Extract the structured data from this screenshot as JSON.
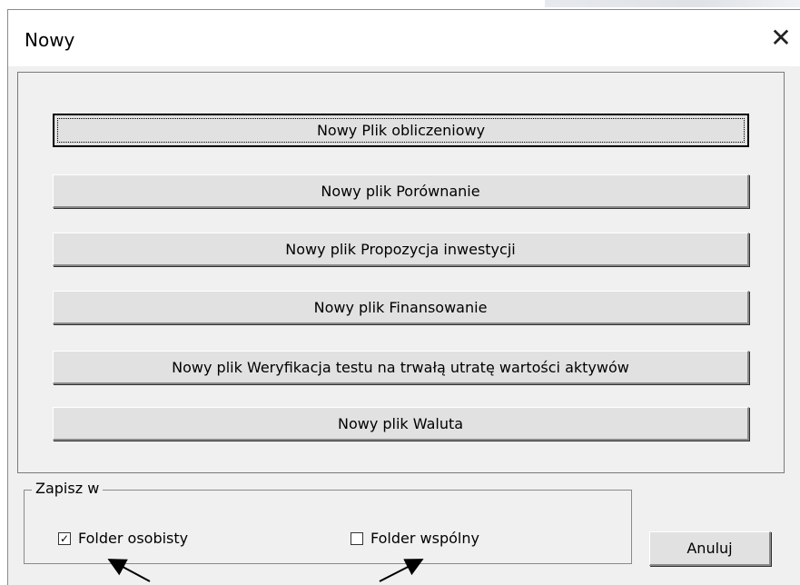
{
  "dialog": {
    "title": "Nowy",
    "close_icon": "close-icon"
  },
  "buttons": [
    {
      "label": "Nowy Plik obliczeniowy",
      "default": true
    },
    {
      "label": "Nowy plik Porównanie"
    },
    {
      "label": "Nowy plik Propozycja inwestycji"
    },
    {
      "label": "Nowy plik Finansowanie"
    },
    {
      "label": "Nowy plik Weryfikacja testu na trwałą utratę wartości aktywów"
    },
    {
      "label": "Nowy plik Waluta"
    }
  ],
  "save_in": {
    "legend": "Zapisz w",
    "options": [
      {
        "label": "Folder osobisty",
        "checked": true
      },
      {
        "label": "Folder wspólny",
        "checked": false
      }
    ]
  },
  "cancel_label": "Anuluj",
  "colors": {
    "dialog_bg": "#f0f0f0",
    "button_face": "#e1e1e1",
    "titlebar_bg": "#ffffff"
  }
}
